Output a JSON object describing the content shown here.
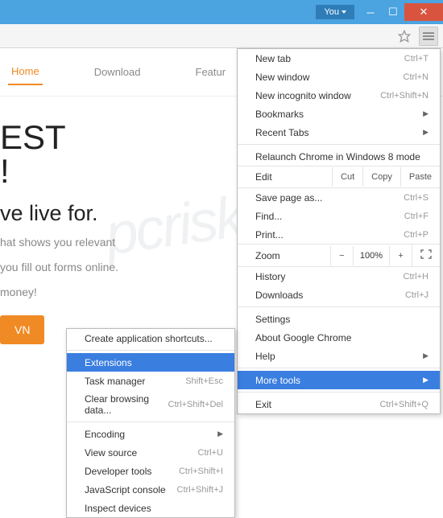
{
  "titlebar": {
    "user": "You"
  },
  "nav": {
    "home": "Home",
    "download": "Download",
    "features": "Featur"
  },
  "hero": {
    "title1": "EST",
    "title2": "!",
    "sub": "ve live for.",
    "desc1": "hat shows you relevant",
    "desc2": "you fill out forms online.",
    "desc3": "money!",
    "btn": "VN"
  },
  "menu": {
    "new_tab": "New tab",
    "new_tab_sc": "Ctrl+T",
    "new_window": "New window",
    "new_window_sc": "Ctrl+N",
    "new_incognito": "New incognito window",
    "new_incognito_sc": "Ctrl+Shift+N",
    "bookmarks": "Bookmarks",
    "recent_tabs": "Recent Tabs",
    "relaunch": "Relaunch Chrome in Windows 8 mode",
    "edit": "Edit",
    "cut": "Cut",
    "copy": "Copy",
    "paste": "Paste",
    "save_as": "Save page as...",
    "save_as_sc": "Ctrl+S",
    "find": "Find...",
    "find_sc": "Ctrl+F",
    "print": "Print...",
    "print_sc": "Ctrl+P",
    "zoom": "Zoom",
    "zoom_val": "100%",
    "history": "History",
    "history_sc": "Ctrl+H",
    "downloads": "Downloads",
    "downloads_sc": "Ctrl+J",
    "settings": "Settings",
    "about": "About Google Chrome",
    "help": "Help",
    "more_tools": "More tools",
    "exit": "Exit",
    "exit_sc": "Ctrl+Shift+Q"
  },
  "submenu": {
    "create_shortcuts": "Create application shortcuts...",
    "extensions": "Extensions",
    "task_manager": "Task manager",
    "task_manager_sc": "Shift+Esc",
    "clear_data": "Clear browsing data...",
    "clear_data_sc": "Ctrl+Shift+Del",
    "encoding": "Encoding",
    "view_source": "View source",
    "view_source_sc": "Ctrl+U",
    "dev_tools": "Developer tools",
    "dev_tools_sc": "Ctrl+Shift+I",
    "js_console": "JavaScript console",
    "js_console_sc": "Ctrl+Shift+J",
    "inspect": "Inspect devices"
  },
  "watermark": "pcrisk.com"
}
